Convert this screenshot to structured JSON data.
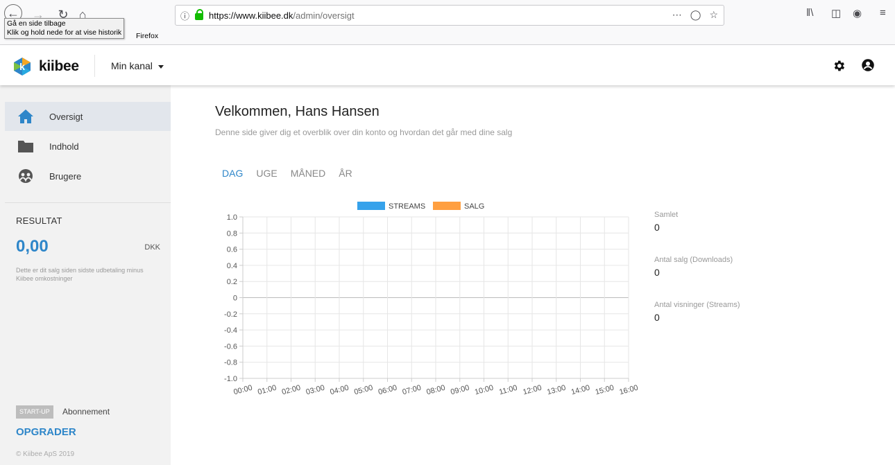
{
  "browser": {
    "tooltip_line1": "Gå en side tilbage",
    "tooltip_line2": "Klik og hold nede for at vise historik",
    "tooltip_tail": "Firefox",
    "url_host": "https://www.kiibee.dk",
    "url_path": "/admin/oversigt"
  },
  "header": {
    "brand": "kiibee",
    "channel": "Min kanal"
  },
  "sidebar": {
    "items": [
      {
        "label": "Oversigt",
        "icon": "home-icon"
      },
      {
        "label": "Indhold",
        "icon": "folder-icon"
      },
      {
        "label": "Brugere",
        "icon": "users-icon"
      }
    ],
    "result_title": "RESULTAT",
    "result_amount": "0,00",
    "result_currency": "DKK",
    "result_desc": "Dette er dit salg siden sidste udbetaling minus Kiibee omkostninger",
    "plan_badge": "START-UP",
    "plan_label": "Abonnement",
    "upgrade": "OPGRADER",
    "copyright": "© Kiibee ApS 2019"
  },
  "main": {
    "welcome": "Velkommen, Hans Hansen",
    "subtitle": "Denne side giver dig et overblik over din konto og hvordan det går med dine salg",
    "tabs": [
      "DAG",
      "UGE",
      "MÅNED",
      "ÅR"
    ],
    "active_tab": "DAG"
  },
  "stats": [
    {
      "label": "Samlet",
      "value": "0"
    },
    {
      "label": "Antal salg (Downloads)",
      "value": "0"
    },
    {
      "label": "Antal visninger (Streams)",
      "value": "0"
    }
  ],
  "colors": {
    "accent": "#2e86c9",
    "streams": "#36a2eb",
    "salg": "#ff9f40"
  },
  "chart_data": {
    "type": "line",
    "x": [
      "00:00",
      "01:00",
      "02:00",
      "03:00",
      "04:00",
      "05:00",
      "06:00",
      "07:00",
      "08:00",
      "09:00",
      "10:00",
      "11:00",
      "12:00",
      "13:00",
      "14:00",
      "15:00",
      "16:00"
    ],
    "yticks": [
      "1.0",
      "0.8",
      "0.6",
      "0.4",
      "0.2",
      "0",
      "-0.2",
      "-0.4",
      "-0.6",
      "-0.8",
      "-1.0"
    ],
    "ylim": [
      -1.0,
      1.0
    ],
    "series": [
      {
        "name": "STREAMS",
        "values": [
          0,
          0,
          0,
          0,
          0,
          0,
          0,
          0,
          0,
          0,
          0,
          0,
          0,
          0,
          0,
          0,
          0
        ]
      },
      {
        "name": "SALG",
        "values": [
          0,
          0,
          0,
          0,
          0,
          0,
          0,
          0,
          0,
          0,
          0,
          0,
          0,
          0,
          0,
          0,
          0
        ]
      }
    ],
    "legend": "top",
    "grid": true
  }
}
